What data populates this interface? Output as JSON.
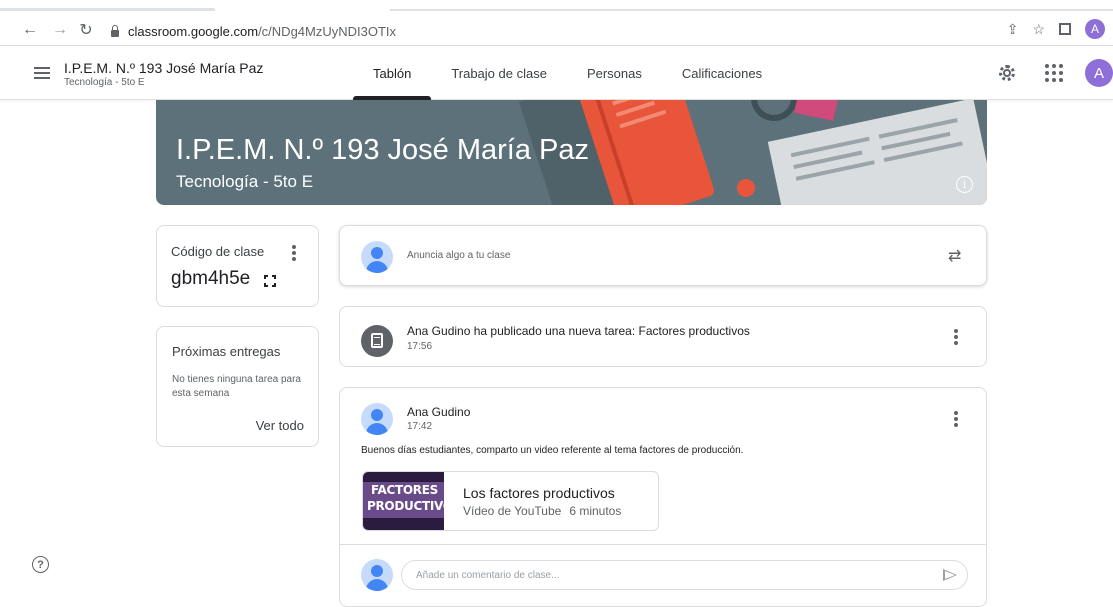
{
  "browser": {
    "url_domain": "classroom.google.com",
    "url_path": "/c/NDg4MzUyNDI3OTIx",
    "profile_initial": "A"
  },
  "header": {
    "class_name": "I.P.E.M. N.º 193 José María Paz",
    "class_section": "Tecnología - 5to E",
    "tabs": [
      {
        "label": "Tablón",
        "active": true
      },
      {
        "label": "Trabajo de clase",
        "active": false
      },
      {
        "label": "Personas",
        "active": false
      },
      {
        "label": "Calificaciones",
        "active": false
      }
    ],
    "avatar_initial": "A"
  },
  "banner": {
    "title": "I.P.E.M. N.º 193 José María Paz",
    "subtitle": "Tecnología - 5to E",
    "background": "#5c7179"
  },
  "class_code": {
    "label": "Código de clase",
    "value": "gbm4h5e"
  },
  "upcoming": {
    "title": "Próximas entregas",
    "empty_message": "No tienes ninguna tarea para esta semana",
    "see_all": "Ver todo"
  },
  "announce": {
    "placeholder": "Anuncia algo a tu clase"
  },
  "posts": [
    {
      "type": "assignment",
      "title": "Ana Gudino ha publicado una nueva tarea: Factores productivos",
      "time": "17:56"
    },
    {
      "type": "announcement",
      "author": "Ana Gudino",
      "time": "17:42",
      "body": "Buenos días estudiantes, comparto un video referente al tema factores de producción.",
      "attachment": {
        "thumb_line1": "FACTORES",
        "thumb_line2": "PRODUCTIVOS",
        "title": "Los factores productivos",
        "source": "Vídeo de YouTube",
        "duration": "6 minutos"
      },
      "comment_placeholder": "Añade un comentario de clase..."
    }
  ],
  "colors": {
    "accent_avatar": "#8e6fd8",
    "person_avatar": "#4285f4"
  }
}
